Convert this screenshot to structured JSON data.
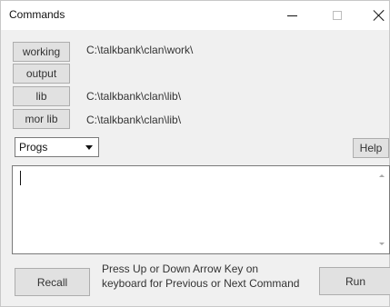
{
  "window": {
    "title": "Commands",
    "minimize_glyph": "–",
    "maximize_glyph": "□",
    "close_glyph": "×"
  },
  "directories": [
    {
      "label": "working",
      "path": "C:\\talkbank\\clan\\work\\"
    },
    {
      "label": "output",
      "path": ""
    },
    {
      "label": "lib",
      "path": "C:\\talkbank\\clan\\lib\\"
    },
    {
      "label": "mor lib",
      "path": "C:\\talkbank\\clan\\lib\\"
    }
  ],
  "progs": {
    "selected": "Progs"
  },
  "help_label": "Help",
  "command_input": {
    "value": ""
  },
  "recall_label": "Recall",
  "hint_text": "Press Up or Down Arrow Key on keyboard for Previous or Next Command",
  "run_label": "Run"
}
